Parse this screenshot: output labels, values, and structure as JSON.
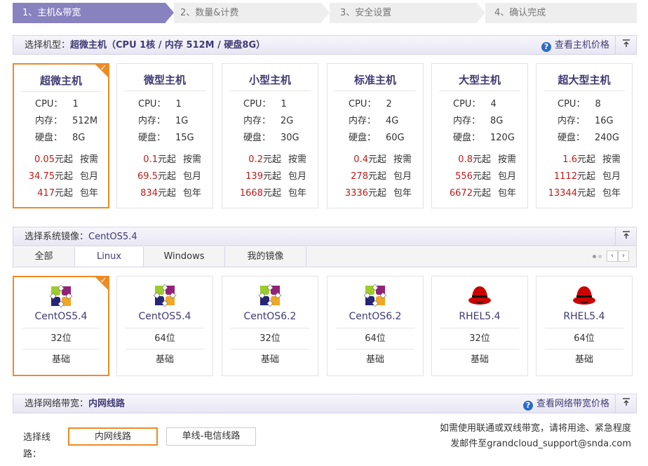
{
  "steps": [
    {
      "label": "1、主机&带宽"
    },
    {
      "label": "2、数量&计费"
    },
    {
      "label": "3、安全设置"
    },
    {
      "label": "4、确认完成"
    }
  ],
  "machine_section": {
    "prefix": "选择机型：",
    "selected": "超微主机（CPU 1核 / 内存 512M / 硬盘8G）",
    "price_link": "查看主机价格"
  },
  "machines": [
    {
      "name": "超微主机",
      "cpu": "1",
      "mem": "512M",
      "disk": "8G",
      "p1": "0.05",
      "p2": "34.75",
      "p3": "417"
    },
    {
      "name": "微型主机",
      "cpu": "1",
      "mem": "1G",
      "disk": "15G",
      "p1": "0.1",
      "p2": "69.5",
      "p3": "834"
    },
    {
      "name": "小型主机",
      "cpu": "1",
      "mem": "2G",
      "disk": "30G",
      "p1": "0.2",
      "p2": "139",
      "p3": "1668"
    },
    {
      "name": "标准主机",
      "cpu": "2",
      "mem": "4G",
      "disk": "60G",
      "p1": "0.4",
      "p2": "278",
      "p3": "3336"
    },
    {
      "name": "大型主机",
      "cpu": "4",
      "mem": "8G",
      "disk": "120G",
      "p1": "0.8",
      "p2": "556",
      "p3": "6672"
    },
    {
      "name": "超大型主机",
      "cpu": "8",
      "mem": "16G",
      "disk": "240G",
      "p1": "1.6",
      "p2": "1112",
      "p3": "13344"
    }
  ],
  "spec_labels": {
    "cpu": "CPU：",
    "mem": "内存：",
    "disk": "硬盘："
  },
  "price_labels": {
    "unit": "元起",
    "hourly": "按需",
    "monthly": "包月",
    "yearly": "包年"
  },
  "image_section": {
    "prefix": "选择系统镜像：",
    "selected": "CentOS5.4"
  },
  "os_tabs": [
    {
      "label": "全部"
    },
    {
      "label": "Linux"
    },
    {
      "label": "Windows"
    },
    {
      "label": "我的镜像"
    }
  ],
  "os_images": [
    {
      "name": "CentOS5.4",
      "bits": "32位",
      "tier": "基础",
      "logo": "centos-logo"
    },
    {
      "name": "CentOS5.4",
      "bits": "64位",
      "tier": "基础",
      "logo": "centos-logo"
    },
    {
      "name": "CentOS6.2",
      "bits": "32位",
      "tier": "基础",
      "logo": "centos-logo"
    },
    {
      "name": "CentOS6.2",
      "bits": "64位",
      "tier": "基础",
      "logo": "centos-logo"
    },
    {
      "name": "RHEL5.4",
      "bits": "32位",
      "tier": "基础",
      "logo": "redhat-logo"
    },
    {
      "name": "RHEL5.4",
      "bits": "64位",
      "tier": "基础",
      "logo": "redhat-logo"
    }
  ],
  "bandwidth_section": {
    "prefix": "选择网络带宽：",
    "selected": "内网线路",
    "price_link": "查看网络带宽价格"
  },
  "bandwidth": {
    "label": "选择线路：",
    "options": [
      {
        "label": "内网线路"
      },
      {
        "label": "单线-电信线路"
      }
    ],
    "note_line1": "如需使用联通或双线带宽，请将用途、紧急程度",
    "note_line2": "发邮件至grandcloud_support@snda.com"
  },
  "colors": {
    "accent": "#f08a24",
    "brand": "#3f3a75",
    "price": "#c21a1a",
    "step_active": "#7d78b8"
  }
}
